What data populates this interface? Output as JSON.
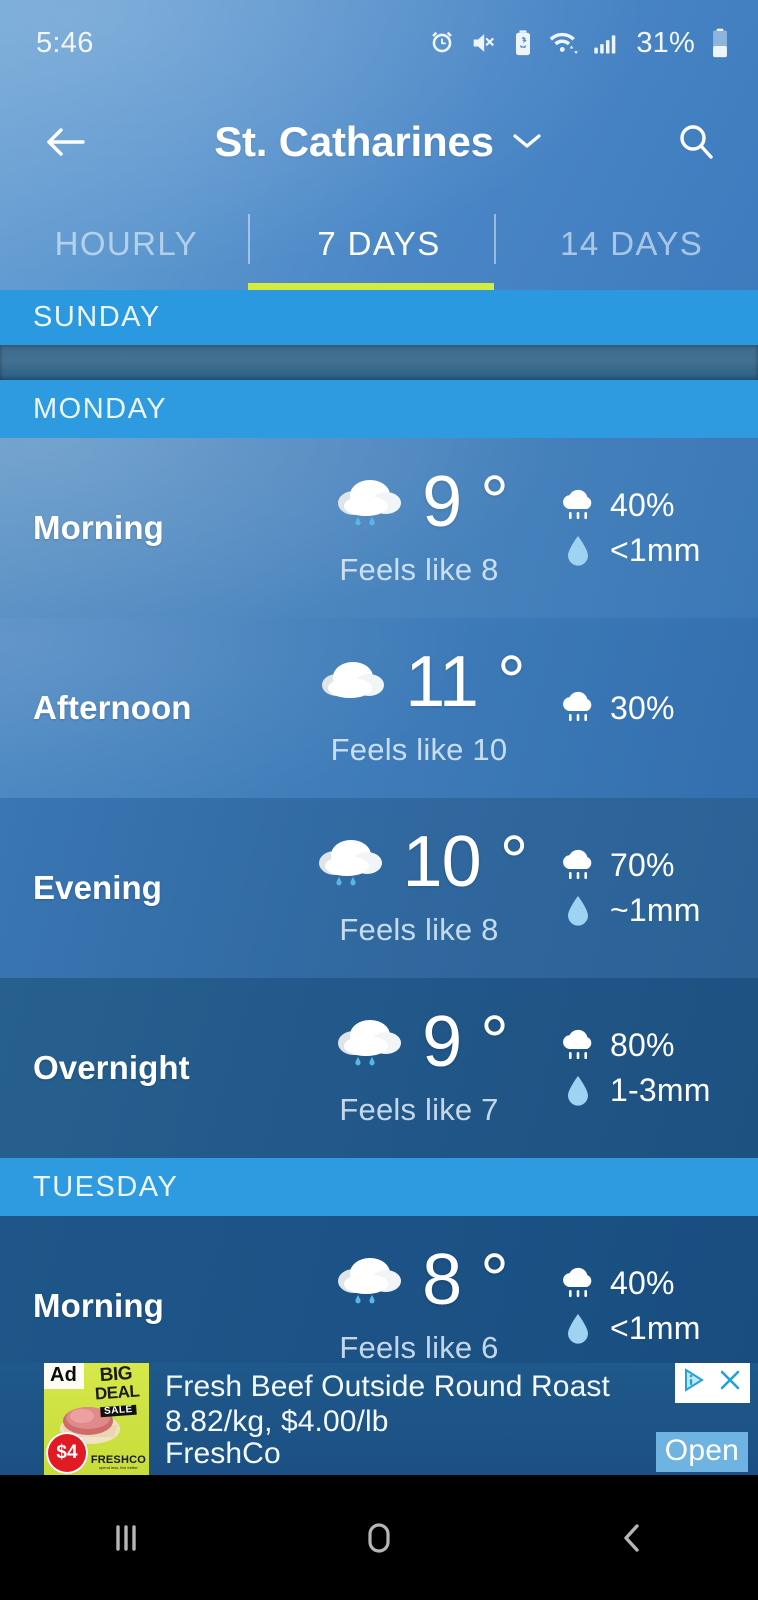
{
  "status_bar": {
    "time": "5:46",
    "battery_percent": "31%",
    "icons": [
      "alarm-icon",
      "mute-icon",
      "battery-saver-icon",
      "wifi-icon",
      "signal-icon",
      "battery-icon"
    ]
  },
  "app_bar": {
    "back_icon": "back-arrow-icon",
    "title": "St. Catharines",
    "dropdown_icon": "chevron-down-icon",
    "search_icon": "search-icon"
  },
  "tabs": {
    "items": [
      {
        "label": "HOURLY",
        "active": false
      },
      {
        "label": "7 DAYS",
        "active": true
      },
      {
        "label": "14 DAYS",
        "active": false
      }
    ],
    "active_index": 1,
    "underline_color": "#d4ec3e"
  },
  "forecast": {
    "days": [
      {
        "name": "SUNDAY",
        "collapsed": true,
        "periods": []
      },
      {
        "name": "MONDAY",
        "collapsed": false,
        "periods": [
          {
            "period": "Morning",
            "temp": "9 °",
            "feels_like": "Feels like 8",
            "condition_icon": "rain-cloud-icon",
            "precip_chance": "40%",
            "precip_amount": "<1mm"
          },
          {
            "period": "Afternoon",
            "temp": "11 °",
            "feels_like": "Feels like 10",
            "condition_icon": "cloud-icon",
            "precip_chance": "30%",
            "precip_amount": ""
          },
          {
            "period": "Evening",
            "temp": "10 °",
            "feels_like": "Feels like 8",
            "condition_icon": "rain-cloud-icon",
            "precip_chance": "70%",
            "precip_amount": "~1mm"
          },
          {
            "period": "Overnight",
            "temp": "9 °",
            "feels_like": "Feels like 7",
            "condition_icon": "rain-cloud-icon",
            "precip_chance": "80%",
            "precip_amount": "1-3mm"
          }
        ]
      },
      {
        "name": "TUESDAY",
        "collapsed": false,
        "periods": [
          {
            "period": "Morning",
            "temp": "8 °",
            "feels_like": "Feels like 6",
            "condition_icon": "rain-cloud-icon",
            "precip_chance": "40%",
            "precip_amount": "<1mm"
          }
        ]
      }
    ]
  },
  "ad": {
    "badge": "Ad",
    "thumb_big": "BIG",
    "thumb_deal": "DEAL",
    "thumb_sale": "SALE",
    "thumb_price": "$4",
    "thumb_brand": "FRESHCO",
    "thumb_brand_sub": "spend less, live better",
    "headline": "Fresh Beef Outside Round Roast 8.82/kg, $4.00/lb",
    "advertiser": "FreshCo",
    "cta": "Open",
    "adchoices_icon": "adchoices-icon",
    "close_icon": "close-icon"
  },
  "nav_bar": {
    "recents_icon": "recents-icon",
    "home_icon": "home-icon",
    "back_icon": "back-icon"
  }
}
